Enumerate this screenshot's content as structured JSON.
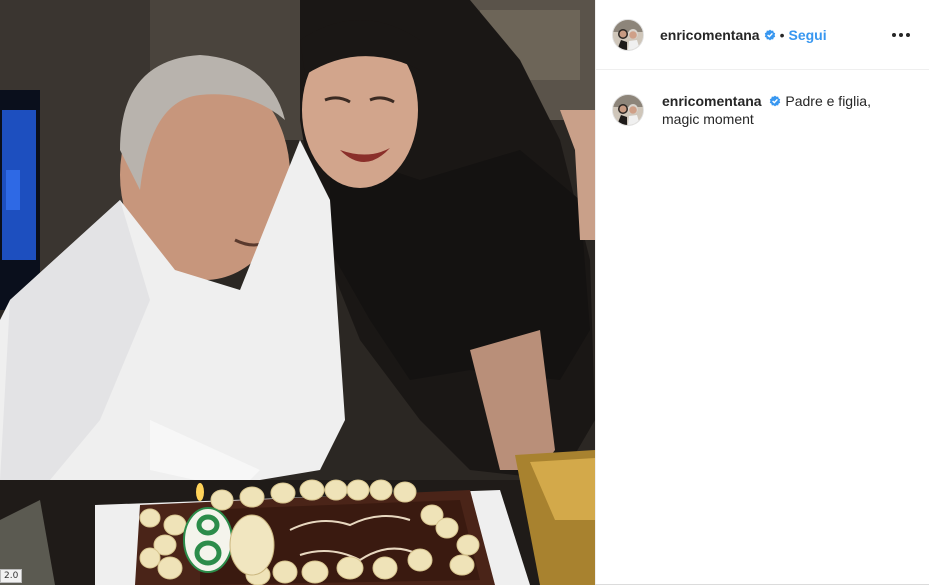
{
  "post": {
    "author": {
      "username": "enricomentana",
      "verified": true,
      "avatar_icon": "user-avatar-photo"
    },
    "follow_label": "Segui",
    "separator": "•",
    "more_icon": "more-options-icon",
    "caption": {
      "username": "enricomentana",
      "text": "Padre e figlia, magic moment"
    },
    "media": {
      "cake_candle_number": "8"
    }
  },
  "overlay": {
    "version_badge": "2.0"
  },
  "colors": {
    "link_blue": "#3897f0",
    "text": "#262626",
    "border": "#efefef"
  }
}
